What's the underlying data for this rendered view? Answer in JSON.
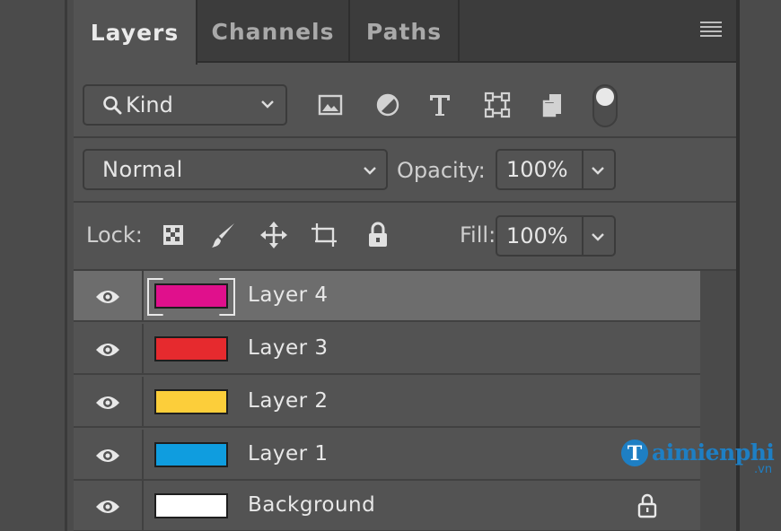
{
  "tabs": [
    {
      "label": "Layers",
      "active": true
    },
    {
      "label": "Channels",
      "active": false
    },
    {
      "label": "Paths",
      "active": false
    }
  ],
  "filter": {
    "kind_label": "Kind",
    "icons": [
      "image-filter-icon",
      "adjustment-filter-icon",
      "type-filter-icon",
      "shape-filter-icon",
      "smart-object-filter-icon",
      "filter-toggle-switch"
    ]
  },
  "blend": {
    "mode": "Normal",
    "opacity_label": "Opacity:",
    "opacity_value": "100%"
  },
  "lock": {
    "label": "Lock:",
    "fill_label": "Fill:",
    "fill_value": "100%"
  },
  "layers": [
    {
      "name": "Layer 4",
      "color": "#e0108c",
      "selected": true,
      "locked": false
    },
    {
      "name": "Layer 3",
      "color": "#e62a2e",
      "selected": false,
      "locked": false
    },
    {
      "name": "Layer 2",
      "color": "#fcce3a",
      "selected": false,
      "locked": false
    },
    {
      "name": "Layer 1",
      "color": "#0f9ddf",
      "selected": false,
      "locked": false
    },
    {
      "name": "Background",
      "color": "#ffffff",
      "selected": false,
      "locked": true
    }
  ],
  "watermark": {
    "text": "aimienphi",
    "suffix": ".vn",
    "logo_letter": "T"
  }
}
